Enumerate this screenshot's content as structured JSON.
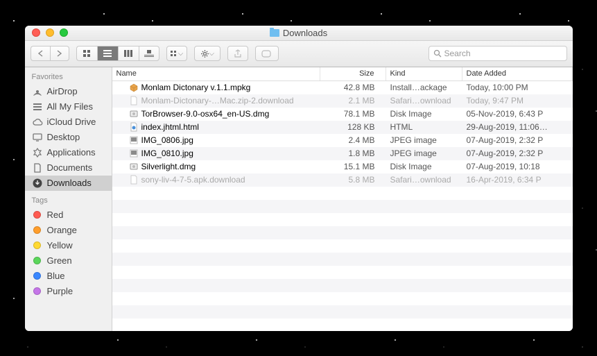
{
  "window": {
    "title": "Downloads"
  },
  "toolbar": {
    "search_placeholder": "Search"
  },
  "sidebar": {
    "sections": [
      {
        "label": "Favorites",
        "items": [
          {
            "icon": "airdrop",
            "label": "AirDrop"
          },
          {
            "icon": "allfiles",
            "label": "All My Files"
          },
          {
            "icon": "cloud",
            "label": "iCloud Drive"
          },
          {
            "icon": "desktop",
            "label": "Desktop"
          },
          {
            "icon": "apps",
            "label": "Applications"
          },
          {
            "icon": "docs",
            "label": "Documents"
          },
          {
            "icon": "downloads",
            "label": "Downloads",
            "selected": true
          }
        ]
      },
      {
        "label": "Tags",
        "items": [
          {
            "icon": "dot",
            "color": "#ff5b51",
            "label": "Red"
          },
          {
            "icon": "dot",
            "color": "#ff9e2c",
            "label": "Orange"
          },
          {
            "icon": "dot",
            "color": "#ffd932",
            "label": "Yellow"
          },
          {
            "icon": "dot",
            "color": "#5bd65b",
            "label": "Green"
          },
          {
            "icon": "dot",
            "color": "#3a87ff",
            "label": "Blue"
          },
          {
            "icon": "dot",
            "color": "#c576e8",
            "label": "Purple"
          }
        ]
      }
    ]
  },
  "columns": {
    "name": "Name",
    "size": "Size",
    "kind": "Kind",
    "date": "Date Added"
  },
  "files": [
    {
      "icon": "pkg",
      "name": "Monlam Dictonary v.1.1.mpkg",
      "size": "42.8 MB",
      "kind": "Install…ackage",
      "date": "Today, 10:00 PM",
      "dim": false
    },
    {
      "icon": "blank",
      "name": "Monlam-Dictonary-…Mac.zip-2.download",
      "size": "2.1 MB",
      "kind": "Safari…ownload",
      "date": "Today, 9:47 PM",
      "dim": true
    },
    {
      "icon": "dmg",
      "name": "TorBrowser-9.0-osx64_en-US.dmg",
      "size": "78.1 MB",
      "kind": "Disk Image",
      "date": "05-Nov-2019, 6:43 P",
      "dim": false
    },
    {
      "icon": "html",
      "name": "index.jhtml.html",
      "size": "128 KB",
      "kind": "HTML",
      "date": "29-Aug-2019, 11:06…",
      "dim": false
    },
    {
      "icon": "jpg",
      "name": "IMG_0806.jpg",
      "size": "2.4 MB",
      "kind": "JPEG image",
      "date": "07-Aug-2019, 2:32 P",
      "dim": false
    },
    {
      "icon": "jpg",
      "name": "IMG_0810.jpg",
      "size": "1.8 MB",
      "kind": "JPEG image",
      "date": "07-Aug-2019, 2:32 P",
      "dim": false
    },
    {
      "icon": "dmg",
      "name": "Silverlight.dmg",
      "size": "15.1 MB",
      "kind": "Disk Image",
      "date": "07-Aug-2019, 10:18",
      "dim": false
    },
    {
      "icon": "blank",
      "name": "sony-liv-4-7-5.apk.download",
      "size": "5.8 MB",
      "kind": "Safari…ownload",
      "date": "16-Apr-2019, 6:34 P",
      "dim": true
    }
  ]
}
